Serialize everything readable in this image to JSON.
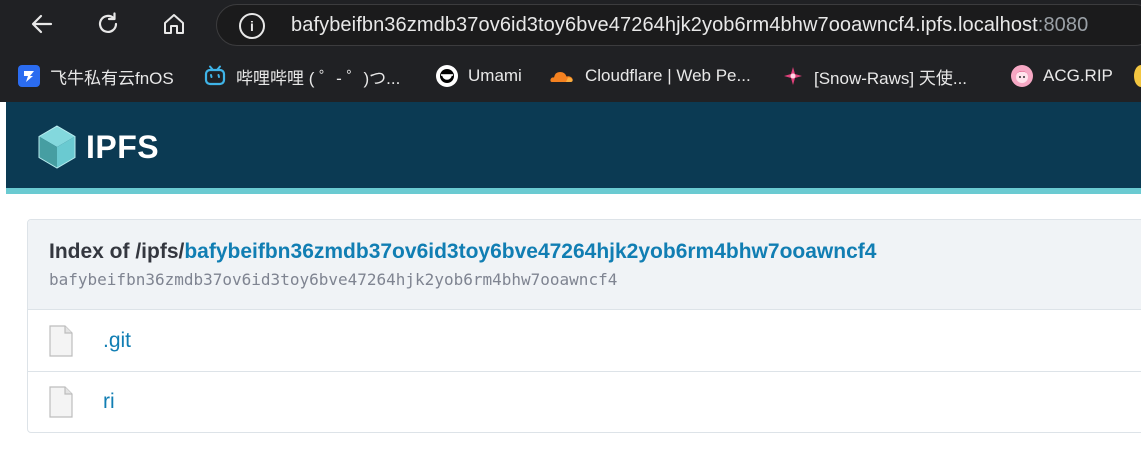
{
  "browser": {
    "url_main": "bafybeifbn36zmdb37ov6id3toy6bve47264hjk2yob6rm4bhw7ooawncf4.ipfs.localhost",
    "url_port": ":8080",
    "bookmarks": [
      {
        "label": "飞牛私有云fnOS",
        "icon": "fnos-icon"
      },
      {
        "label": "哔哩哔哩 ( ゜- ゜)つ...",
        "icon": "bilibili-icon"
      },
      {
        "label": "Umami",
        "icon": "umami-icon"
      },
      {
        "label": "Cloudflare | Web Pe...",
        "icon": "cloudflare-icon"
      },
      {
        "label": "[Snow-Raws] 天使...",
        "icon": "snow-raws-icon"
      },
      {
        "label": "ACG.RIP",
        "icon": "acgrip-icon"
      }
    ]
  },
  "page": {
    "logo_text": "IPFS",
    "index_prefix": "Index of /ipfs/",
    "cid": "bafybeifbn36zmdb37ov6id3toy6bve47264hjk2yob6rm4bhw7ooawncf4",
    "cid_sub": "bafybeifbn36zmdb37ov6id3toy6bve47264hjk2yob6rm4bhw7ooawncf4",
    "files": [
      {
        "name": ".git"
      },
      {
        "name": "ri"
      }
    ]
  },
  "colors": {
    "header_bg": "#0b3a53",
    "header_accent": "#6acad1",
    "link": "#117eb3",
    "chrome_bg": "#202124"
  }
}
